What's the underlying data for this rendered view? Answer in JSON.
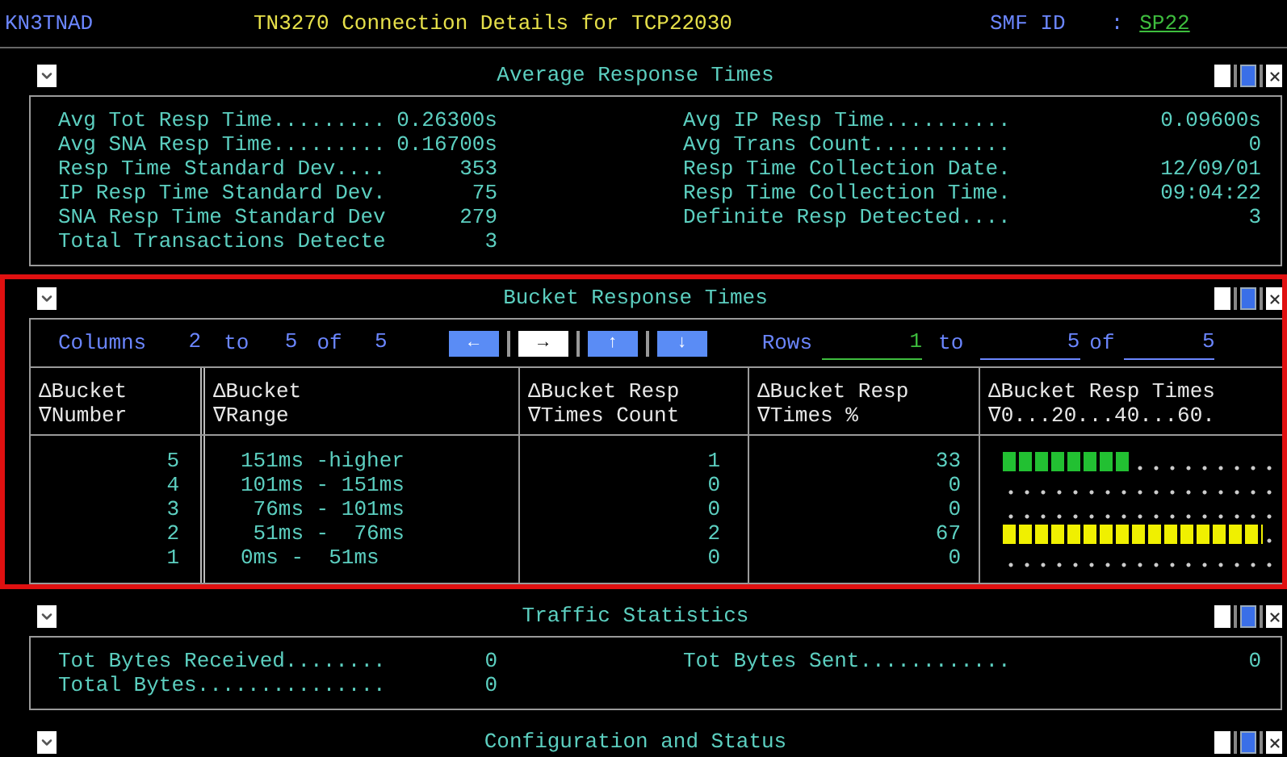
{
  "header": {
    "system": "KN3TNAD",
    "title": "TN3270 Connection Details for TCP22030",
    "smf_label": "SMF ID",
    "separator": ":",
    "smf_value": "SP22"
  },
  "panels": [
    {
      "kind": "stats",
      "title": "Average Response Times",
      "selected": false,
      "rows": [
        [
          {
            "label": "Avg Tot Resp Time.........",
            "value": "0.26300s"
          },
          {
            "label": "Avg IP Resp Time..........",
            "value": "0.09600s"
          }
        ],
        [
          {
            "label": "Avg SNA Resp Time.........",
            "value": "0.16700s"
          },
          {
            "label": "Avg Trans Count...........",
            "value": "0"
          }
        ],
        [
          {
            "label": "Resp Time Standard Dev....",
            "value": "353"
          },
          {
            "label": "Resp Time Collection Date.",
            "value": "12/09/01"
          }
        ],
        [
          {
            "label": "IP Resp Time Standard Dev.",
            "value": "75"
          },
          {
            "label": "Resp Time Collection Time.",
            "value": "09:04:22"
          }
        ],
        [
          {
            "label": "SNA Resp Time Standard Dev",
            "value": "279"
          },
          {
            "label": "Definite Resp Detected....",
            "value": "3"
          }
        ],
        [
          {
            "label": "Total Transactions Detecte",
            "value": "3"
          }
        ]
      ]
    },
    {
      "kind": "table",
      "title": "Bucket Response Times",
      "selected": true,
      "columns_nav": {
        "label": "Columns",
        "from": "2",
        "to_word": "to",
        "to": "5",
        "of_word": "of",
        "total": "5"
      },
      "nav_buttons": [
        {
          "symbol": "←",
          "selected": false
        },
        {
          "symbol": "→",
          "selected": true
        },
        {
          "symbol": "↑",
          "selected": false
        },
        {
          "symbol": "↓",
          "selected": false
        }
      ],
      "rows_nav": {
        "label": "Rows",
        "from": "1",
        "to_word": "to",
        "to": "5",
        "of_word": "of",
        "total": "5"
      },
      "columns": [
        [
          "ΔBucket",
          "∇Number"
        ],
        [
          "ΔBucket",
          "∇Range"
        ],
        [
          "ΔBucket Resp",
          "∇Times Count"
        ],
        [
          "ΔBucket Resp",
          "∇Times %"
        ],
        [
          "ΔBucket Resp Times",
          "∇0...20...40...60."
        ]
      ],
      "rows": [
        {
          "number": "5",
          "range": "151ms -higher",
          "count": "1",
          "percent": "33",
          "level": 0.33,
          "color": "#22c032"
        },
        {
          "number": "4",
          "range": "101ms - 151ms",
          "count": "0",
          "percent": "0",
          "level": 0
        },
        {
          "number": "3",
          "range": " 76ms - 101ms",
          "count": "0",
          "percent": "0",
          "level": 0
        },
        {
          "number": "2",
          "range": " 51ms -  76ms",
          "count": "2",
          "percent": "67",
          "level": 0.67,
          "color": "#f0f000"
        },
        {
          "number": "1",
          "range": "0ms -  51ms",
          "count": "0",
          "percent": "0",
          "level": 0
        }
      ]
    },
    {
      "kind": "stats",
      "title": "Traffic Statistics",
      "selected": false,
      "rows": [
        [
          {
            "label": "Tot Bytes Received........",
            "value": "0"
          },
          {
            "label": "Tot Bytes Sent............",
            "value": "0"
          }
        ],
        [
          {
            "label": "Total Bytes...............",
            "value": "0"
          }
        ]
      ]
    },
    {
      "kind": "collapsed",
      "title": "Configuration and Status",
      "selected": false
    }
  ]
}
